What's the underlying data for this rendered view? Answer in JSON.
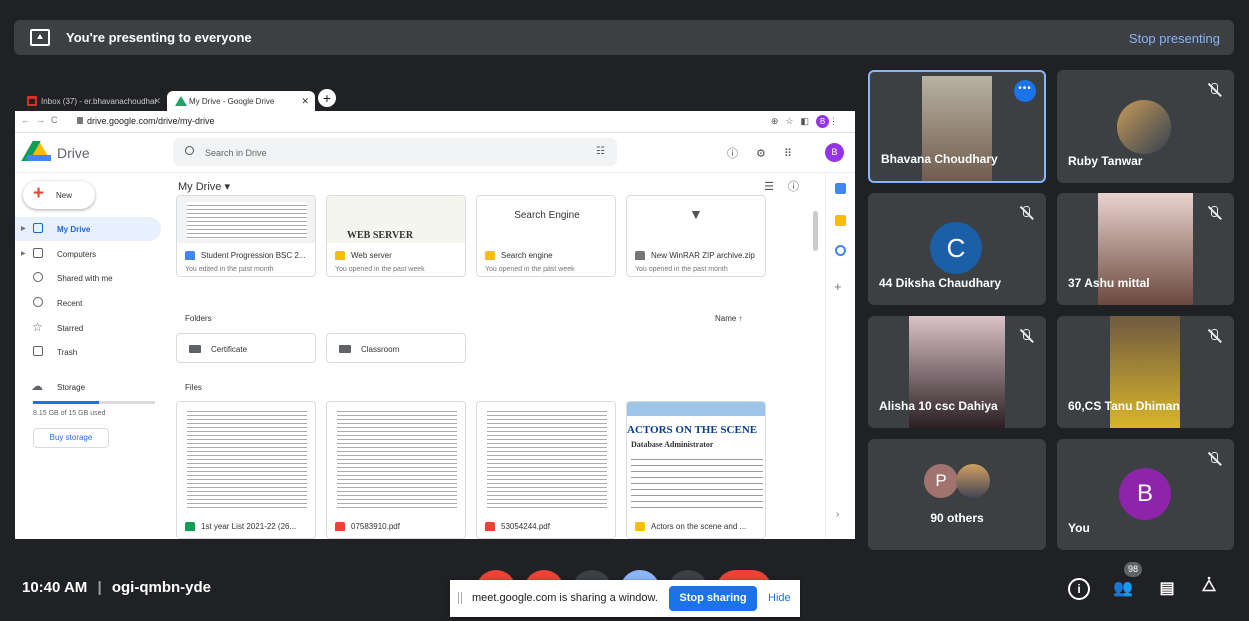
{
  "banner": {
    "text": "You're presenting to everyone",
    "stop": "Stop presenting"
  },
  "browser": {
    "tabs": [
      {
        "label": "Inbox (37) - er.bhavanachoudhar"
      },
      {
        "label": "My Drive - Google Drive"
      }
    ],
    "url": "drive.google.com/drive/my-drive",
    "profile": "B"
  },
  "drive": {
    "title": "Drive",
    "search_placeholder": "Search in Drive",
    "profile": "B",
    "new_label": "New",
    "nav": [
      {
        "label": "My Drive"
      },
      {
        "label": "Computers"
      },
      {
        "label": "Shared with me"
      },
      {
        "label": "Recent"
      },
      {
        "label": "Starred"
      },
      {
        "label": "Trash"
      },
      {
        "label": "Storage"
      }
    ],
    "storage_text": "8.15 GB of 15 GB used",
    "storage_fraction": 0.54,
    "buy_storage": "Buy storage",
    "my_drive": "My Drive",
    "suggested": [
      {
        "name": "Student Progression BSC 2...",
        "sub": "You edited in the past month",
        "color": "#4285f4",
        "thumb_text": ""
      },
      {
        "name": "Web server",
        "sub": "You opened in the past week",
        "color": "#fbbc04",
        "thumb_text": "WEB SERVER"
      },
      {
        "name": "Search engine",
        "sub": "You opened in the past week",
        "color": "#fbbc04",
        "thumb_text": "Search Engine"
      },
      {
        "name": "New WinRAR ZIP archive.zip",
        "sub": "You opened in the past month",
        "color": "#777777",
        "thumb_text": ""
      }
    ],
    "folders_label": "Folders",
    "sort_label": "Name",
    "folders": [
      {
        "name": "Certificate"
      },
      {
        "name": "Classroom"
      }
    ],
    "files_label": "Files",
    "files": [
      {
        "name": "1st year List 2021-22 (26...",
        "color": "#0f9d58"
      },
      {
        "name": "07583910.pdf",
        "color": "#ea4335"
      },
      {
        "name": "53054244.pdf",
        "color": "#ea4335"
      },
      {
        "name": "Actors on the scene and ...",
        "color": "#fbbc04",
        "thumb_title": "ACTORS ON THE SCENE",
        "thumb_sub": "Database Administrator"
      }
    ]
  },
  "participants": [
    {
      "name": "Bhavana Choudhary"
    },
    {
      "name": "Ruby Tanwar"
    },
    {
      "name": "44 Diksha Chaudhary",
      "initial": "C"
    },
    {
      "name": "37 Ashu mittal"
    },
    {
      "name": "Alisha 10 csc Dahiya"
    },
    {
      "name": "60,CS Tanu Dhiman"
    },
    {
      "name": "90 others",
      "initial": "P"
    },
    {
      "name": "You",
      "initial": "B"
    }
  ],
  "bottom": {
    "time": "10:40 AM",
    "separator": "|",
    "meeting_code": "ogi-qmbn-yde",
    "share_msg": "meet.google.com is sharing a window.",
    "stop_sharing": "Stop sharing",
    "hide": "Hide",
    "people_count": "98"
  }
}
